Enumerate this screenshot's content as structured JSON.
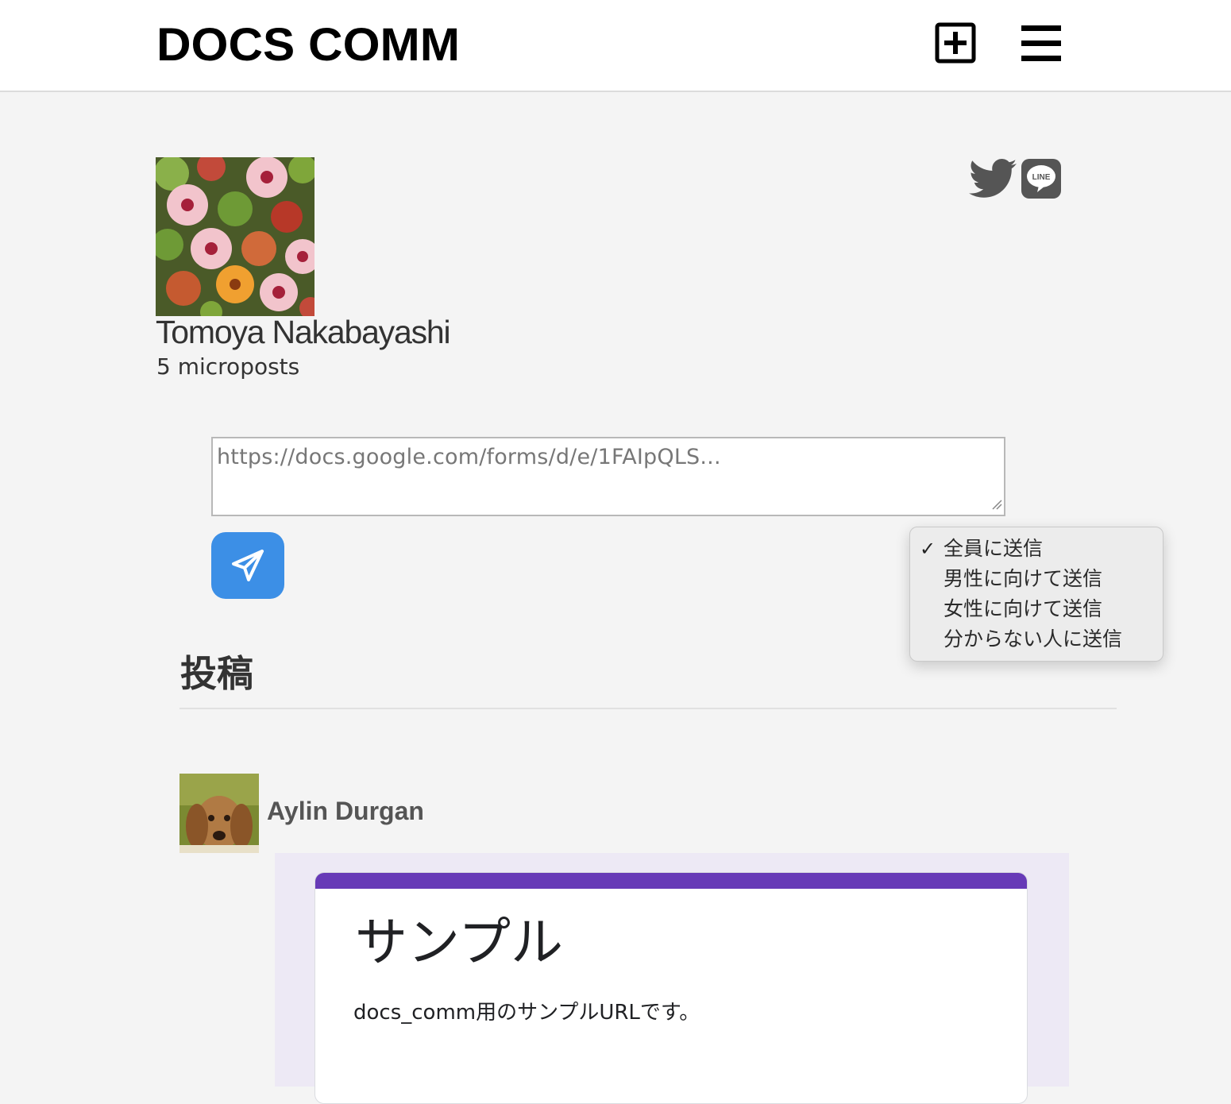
{
  "header": {
    "logo": "DOCS COMM",
    "icons": [
      "plus-square-icon",
      "hamburger-menu-icon"
    ]
  },
  "share": {
    "icons": [
      "twitter-icon",
      "line-icon"
    ],
    "line_label": "LINE"
  },
  "profile": {
    "name": "Tomoya Nakabayashi",
    "post_count": "5 microposts"
  },
  "composer": {
    "url_placeholder": "https://docs.google.com/forms/d/e/1FAIpQLS...",
    "send_icon": "paper-plane-icon",
    "accent_color": "#3c8fe6"
  },
  "audience_dropdown": {
    "options": [
      {
        "label": "全員に送信",
        "selected": true
      },
      {
        "label": "男性に向けて送信",
        "selected": false
      },
      {
        "label": "女性に向けて送信",
        "selected": false
      },
      {
        "label": "分からない人に送信",
        "selected": false
      }
    ],
    "check_mark": "✓"
  },
  "feed": {
    "section_title": "投稿",
    "posts": [
      {
        "author": "Aylin Durgan",
        "form": {
          "title": "サンプル",
          "description": "docs_comm用のサンプルURLです。",
          "accent_color": "#673ab7"
        }
      }
    ]
  }
}
